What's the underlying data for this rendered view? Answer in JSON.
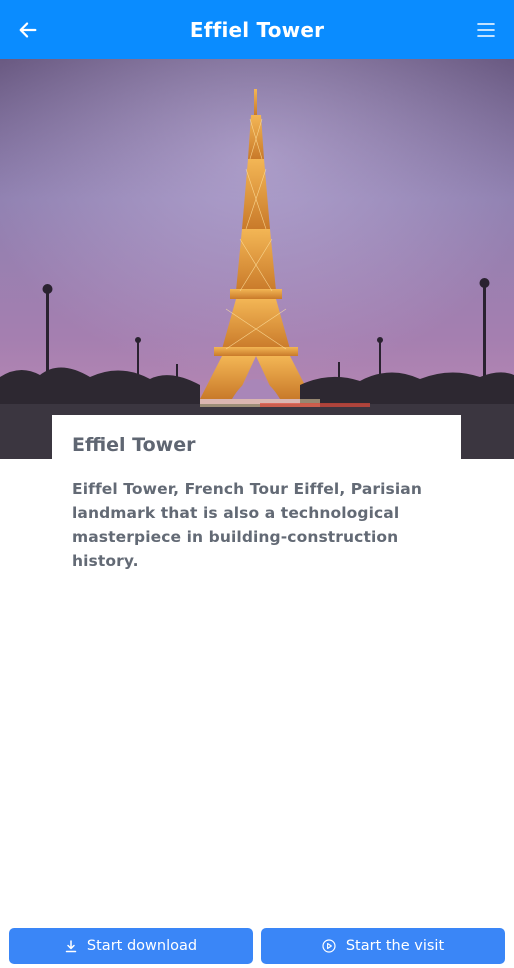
{
  "header": {
    "title": "Effiel Tower",
    "back_icon": "arrow-left-icon",
    "menu_icon": "hamburger-menu-icon",
    "background_color": "#0a8cff"
  },
  "hero": {
    "image_subject": "Eiffel Tower at dusk under a purple sky"
  },
  "card": {
    "title": "Effiel Tower",
    "description": "Eiffel Tower, French Tour Eiffel, Parisian landmark that is also a technological masterpiece in building-construction history."
  },
  "actions": {
    "download_label": "Start download",
    "download_icon": "download-icon",
    "visit_label": "Start the visit",
    "visit_icon": "play-circle-icon",
    "button_color": "#3a86f7"
  }
}
